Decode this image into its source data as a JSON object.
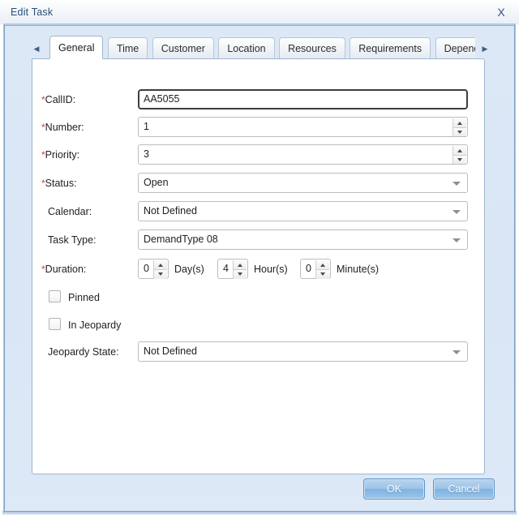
{
  "window": {
    "title": "Edit Task",
    "close_icon": "close-icon",
    "close_label": "X"
  },
  "tabs": {
    "scroll_left_glyph": "◀",
    "scroll_right_glyph": "▶",
    "items": [
      {
        "label": "General",
        "active": true
      },
      {
        "label": "Time",
        "active": false
      },
      {
        "label": "Customer",
        "active": false
      },
      {
        "label": "Location",
        "active": false
      },
      {
        "label": "Resources",
        "active": false
      },
      {
        "label": "Requirements",
        "active": false
      },
      {
        "label": "Depend",
        "active": false
      }
    ]
  },
  "form": {
    "callid": {
      "required_marker": "*",
      "label": "CallID:",
      "value": "AA5055"
    },
    "number": {
      "required_marker": "*",
      "label": "Number:",
      "value": "1"
    },
    "priority": {
      "required_marker": "*",
      "label": "Priority:",
      "value": "3"
    },
    "status": {
      "required_marker": "*",
      "label": "Status:",
      "value": "Open"
    },
    "calendar": {
      "label": "Calendar:",
      "value": "Not Defined"
    },
    "task_type": {
      "label": "Task Type:",
      "value": "DemandType 08"
    },
    "duration": {
      "required_marker": "*",
      "label": "Duration:",
      "days_value": "0",
      "days_unit": "Day(s)",
      "hours_value": "4",
      "hours_unit": "Hour(s)",
      "minutes_value": "0",
      "minutes_unit": "Minute(s)"
    },
    "pinned": {
      "label": "Pinned",
      "checked": false
    },
    "in_jeopardy": {
      "label": "In Jeopardy",
      "checked": false
    },
    "jeopardy_state": {
      "label": "Jeopardy State:",
      "value": "Not Defined"
    }
  },
  "footer": {
    "ok_label": "OK",
    "cancel_label": "Cancel"
  },
  "colors": {
    "dialog_blue": "#dce8f6",
    "title_text": "#2a4f79",
    "required_red": "#d23b3b",
    "button_blue": "#9cc4e8",
    "panel_border": "#9fb6cd"
  }
}
